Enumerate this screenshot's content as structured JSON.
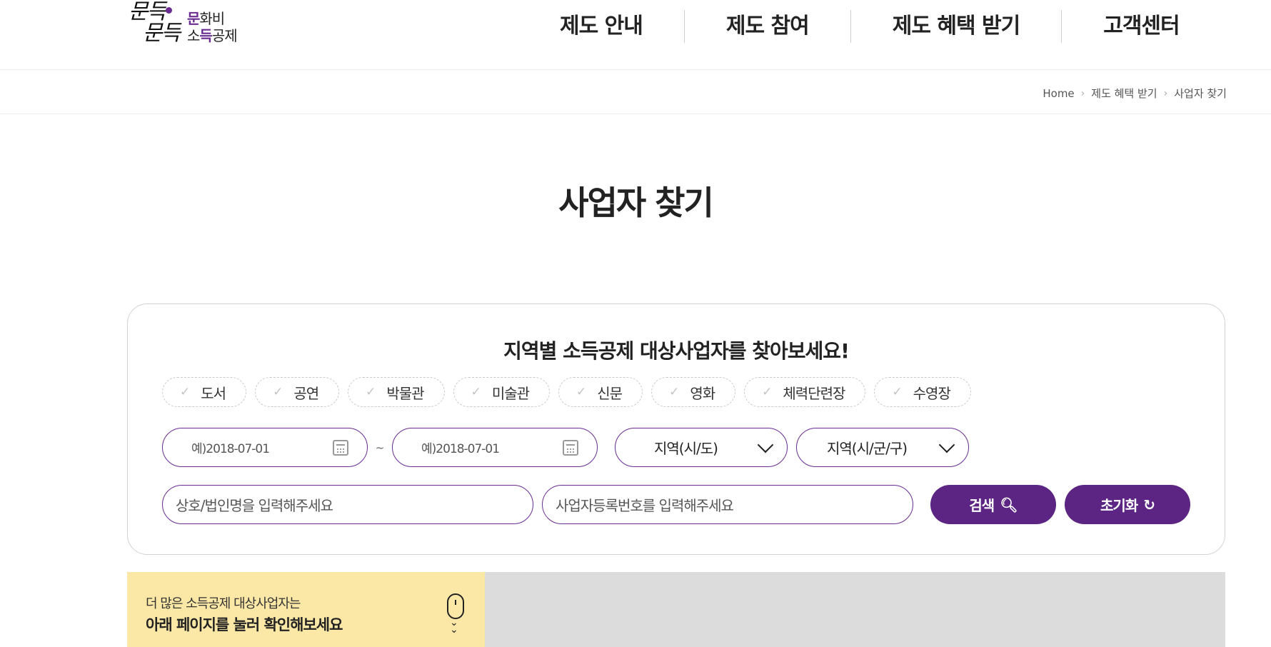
{
  "logo": {
    "hand_line1": "문득",
    "hand_line2": "문득",
    "text_line1_purple": "문",
    "text_line1_rest": "화비",
    "text_line2_pre": "소",
    "text_line2_purple": "득",
    "text_line2_rest": "공제"
  },
  "nav": {
    "items": [
      "제도 안내",
      "제도 참여",
      "제도 혜택 받기",
      "고객센터"
    ]
  },
  "breadcrumb": {
    "items": [
      "Home",
      "제도 혜택 받기",
      "사업자 찾기"
    ]
  },
  "page_title": "사업자 찾기",
  "search": {
    "heading": "지역별 소득공제 대상사업자를 찾아보세요!",
    "categories": [
      "도서",
      "공연",
      "박물관",
      "미술관",
      "신문",
      "영화",
      "체력단련장",
      "수영장"
    ],
    "date_from_placeholder": "예)2018-07-01",
    "date_separator": "~",
    "date_to_placeholder": "예)2018-07-01",
    "region_province": "지역(시/도)",
    "region_district": "지역(시/군/구)",
    "company_placeholder": "상호/법인명을 입력해주세요",
    "bizno_placeholder": "사업자등록번호를 입력해주세요",
    "search_button": "검색",
    "reset_button": "초기화",
    "accent_color": "#5c2583"
  },
  "notice": {
    "small": "더 많은 소득공제 대상사업자는",
    "big": "아래 페이지를 눌러 확인해보세요",
    "bg_color": "#fbe8a6"
  }
}
